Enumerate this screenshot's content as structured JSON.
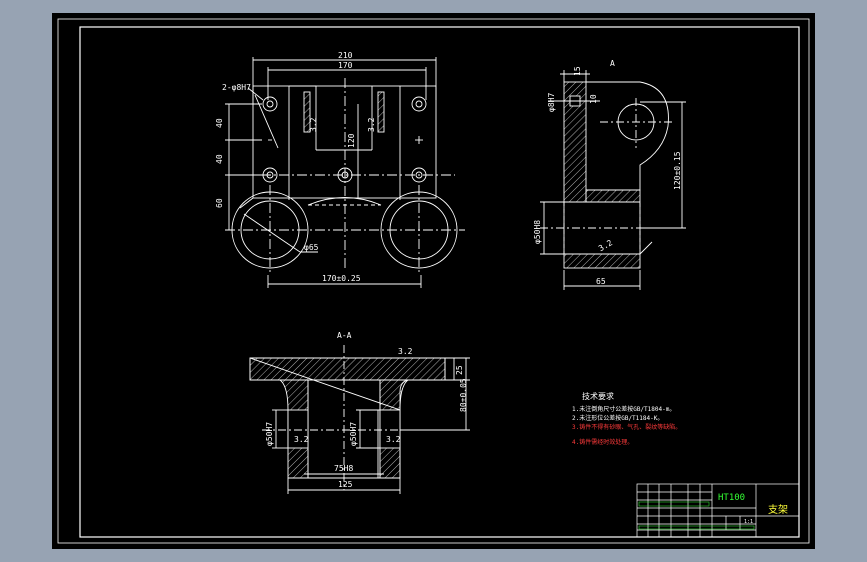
{
  "colors": {
    "background": "#97a3b3",
    "sheet": "#000000",
    "line": "#ffffff",
    "dim_red": "#ff3b3b",
    "hatch": "#ffffff",
    "green": "#34ff34",
    "yellow": "#ffff3a",
    "cyan": "#5ee0ff"
  },
  "top_view": {
    "dim_overall": "210",
    "dim_inner": "170",
    "dim_bottom": "170±0.25",
    "hole_note": "2-φ8H7",
    "dia_note": "φ65",
    "dim_left_1": "40",
    "dim_left_2": "40",
    "dim_left_3": "60",
    "dim_mid": "120",
    "rough_1": "3.2",
    "rough_2": "3.2"
  },
  "side_view": {
    "dim_top": "15",
    "dim_left_small": "φ8H7",
    "dim_small_2": "10",
    "dim_height": "120±0.15",
    "dim_bore": "φ50H8",
    "dim_width": "65",
    "rough": "3.2",
    "label_top": "A"
  },
  "section_view": {
    "label": "A-A",
    "dim_right_top": "25",
    "dim_right": "80±0.05",
    "dim_bore_left": "φ50H7",
    "dim_bore_mid": "φ50H7",
    "dim_inner": "75H8",
    "dim_width": "125",
    "rough_top": "3.2",
    "rough_1": "3.2",
    "rough_2": "3.2"
  },
  "tech_req": {
    "title": "技术要求",
    "lines": [
      "1.未注倒角尺寸公差按GB/T1804-m。",
      "2.未注形位公差按GB/T1184-K。",
      "3.铸件不得有砂眼、气孔、裂纹等缺陷。",
      "4.铸件需经时效处理。"
    ]
  },
  "title_block": {
    "material": "HT100",
    "part_name": "支架",
    "scale": "1:1"
  }
}
